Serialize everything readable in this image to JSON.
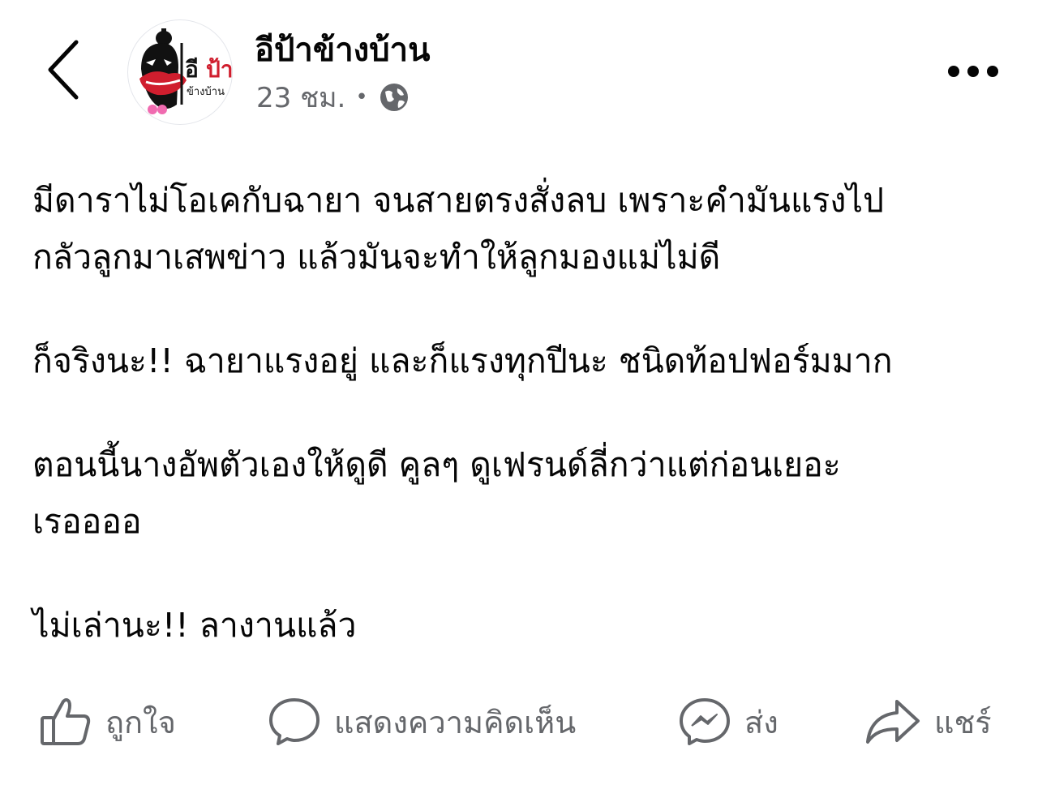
{
  "header": {
    "back_icon": "chevron-left-icon",
    "page_name": "อีป้าข้างบ้าน",
    "avatar_logo_text": "อีป้าข้างบ้าน",
    "timestamp": "23 ชม.",
    "separator": "•",
    "audience_icon": "globe-icon",
    "more_icon": "ellipsis-icon"
  },
  "post": {
    "paragraphs": [
      {
        "lines": [
          "มีดาราไม่โอเคกับฉายา จนสายตรงสั่งลบ เพราะคำมันแรงไป",
          "กลัวลูกมาเสพข่าว แล้วมันจะทำให้ลูกมองแม่ไม่ดี"
        ]
      },
      {
        "lines": [
          "ก็จริงนะ!! ฉายาแรงอยู่ และก็แรงทุกปีนะ ชนิดท้อปฟอร์มมาก"
        ]
      },
      {
        "lines": [
          "ตอนนี้นางอัพตัวเองให้ดูดี คูลๆ ดูเฟรนด์ลี่กว่าแต่ก่อนเยอะ",
          "เรออออ"
        ]
      },
      {
        "lines": [
          "ไม่เล่านะ!! ลางานแล้ว"
        ]
      }
    ]
  },
  "actions": {
    "like": {
      "label": "ถูกใจ",
      "icon": "thumbs-up-icon"
    },
    "comment": {
      "label": "แสดงความคิดเห็น",
      "icon": "comment-bubble-icon"
    },
    "send": {
      "label": "ส่ง",
      "icon": "messenger-icon"
    },
    "share": {
      "label": "แชร์",
      "icon": "share-arrow-icon"
    }
  },
  "colors": {
    "text_primary": "#050505",
    "text_secondary": "#65676b",
    "logo_red": "#d01e2e",
    "background": "#ffffff"
  }
}
